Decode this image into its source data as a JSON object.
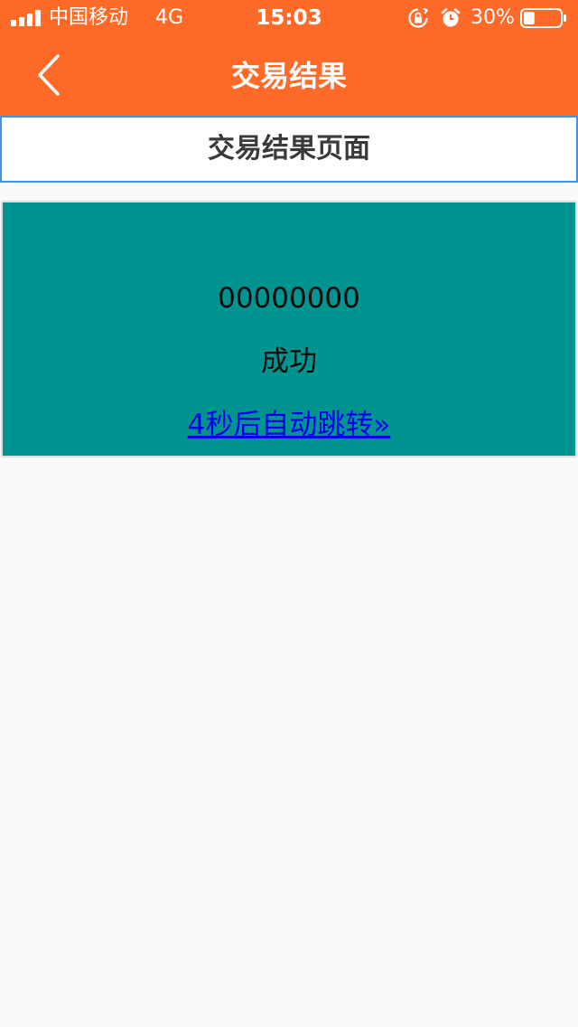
{
  "status_bar": {
    "carrier": "中国移动",
    "network": "4G",
    "time": "15:03",
    "battery_percent": "30%",
    "battery_level": 0.3,
    "icons": [
      "signal-icon",
      "rotation-lock-icon",
      "alarm-icon",
      "battery-icon"
    ]
  },
  "nav": {
    "title": "交易结果",
    "back_icon": "chevron-left-icon"
  },
  "page": {
    "header_title": "交易结果页面"
  },
  "result": {
    "order_number": "00000000",
    "status": "成功",
    "redirect_text": "4秒后自动跳转»"
  },
  "colors": {
    "brand_orange": "#ff6a28",
    "card_teal": "#009490",
    "link_blue": "#0000ee",
    "header_border": "#3d96ee"
  }
}
